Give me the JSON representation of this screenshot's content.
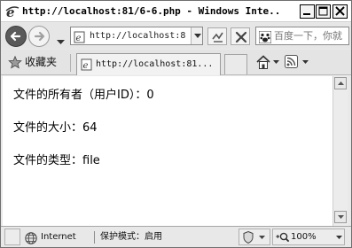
{
  "window": {
    "title": "http://localhost:81/6-6.php - Windows Inte..."
  },
  "nav": {
    "address": "http://localhost:8",
    "search_placeholder": "百度一下，你就"
  },
  "favorites": {
    "label": "收藏夹"
  },
  "tab": {
    "title": "http://localhost:81..."
  },
  "content": {
    "owner_line": "文件的所有者（用户ID）：0",
    "size_line": "文件的大小：64",
    "type_line": "文件的类型：file"
  },
  "status": {
    "zone": "Internet",
    "protected_mode": "保护模式：启用",
    "zoom": "100%"
  },
  "icons": {
    "title": "ie-logo-icon",
    "back": "back-arrow-icon",
    "forward": "forward-arrow-icon",
    "page": "page-icon",
    "compat": "compatibility-view-icon",
    "stop": "stop-icon",
    "search_logo": "baidu-paw-icon",
    "favorites": "favorites-star-icon",
    "home": "home-icon",
    "feeds": "rss-feed-icon",
    "globe": "globe-icon",
    "security": "security-shield-icon",
    "zoom": "zoom-magnifier-icon"
  }
}
